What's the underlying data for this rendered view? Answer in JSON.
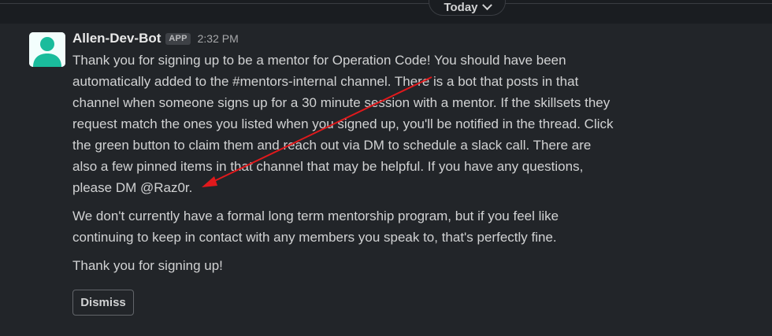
{
  "date_divider": {
    "label": "Today",
    "icon": "chevron-down-icon"
  },
  "message": {
    "avatar_icon": "user-avatar-icon",
    "avatar_color": "#1abc9c",
    "sender": "Allen-Dev-Bot",
    "badge": "APP",
    "timestamp": "2:32 PM",
    "paragraphs": [
      "Thank you for signing up to be a mentor for Operation Code! You should have been\nautomatically added to the #mentors-internal channel. There is a bot that posts in that\nchannel when someone signs up for a 30 minute session with a mentor. If the skillsets they\nrequest match the ones you listed when you signed up, you'll be notified in the thread. Click\nthe green button to claim them and reach out via DM to schedule a slack call. There are\nalso a few pinned items in that channel that may be helpful. If you have any questions,\nplease DM @Raz0r.",
      "We don't currently have a formal long term mentorship program, but if you feel like\ncontinuing to keep in contact with any members you speak to, that's perfectly fine.",
      "Thank you for signing up!"
    ],
    "dismiss_label": "Dismiss"
  },
  "annotation": {
    "type": "arrow",
    "color": "#e0191c"
  },
  "colors": {
    "background": "#1a1d21",
    "message_hover": "#222529",
    "text": "#d1d2d3"
  }
}
